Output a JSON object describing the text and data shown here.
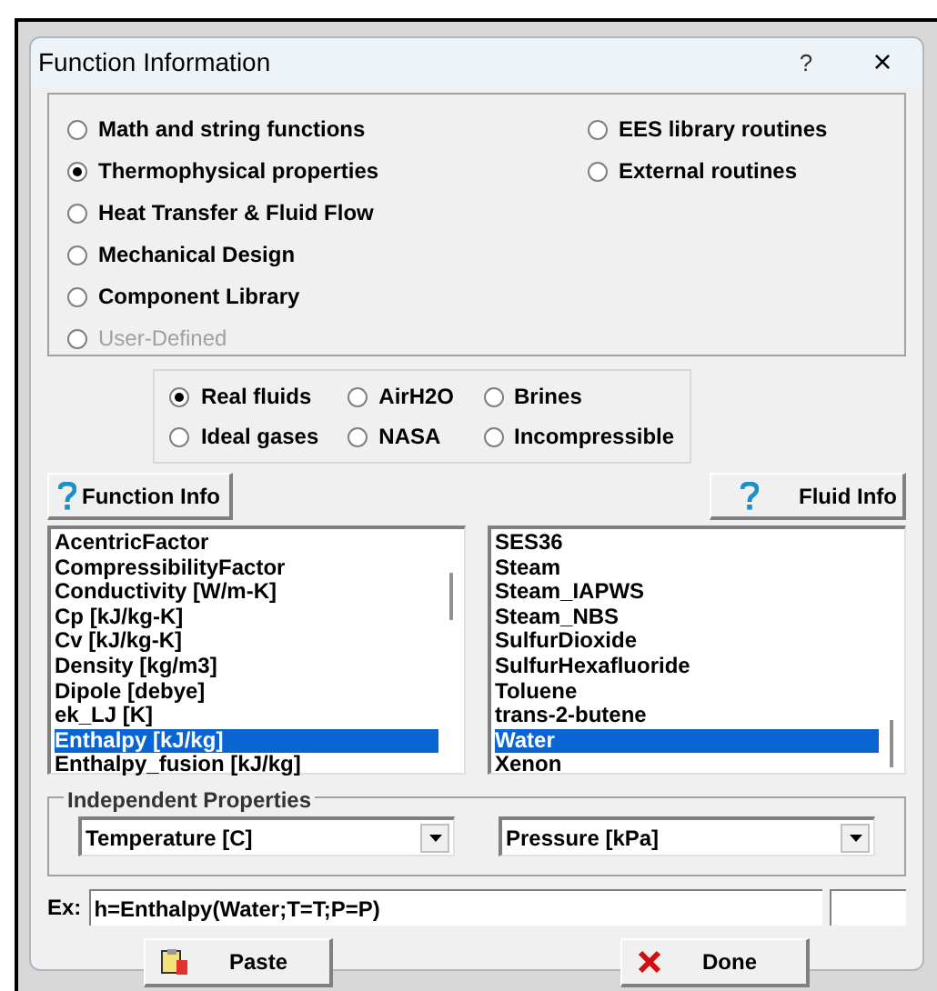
{
  "window": {
    "title": "Function Information",
    "help": "?",
    "close": "×"
  },
  "categories_left": [
    {
      "label": "Math and string functions",
      "selected": false,
      "disabled": false
    },
    {
      "label": "Thermophysical properties",
      "selected": true,
      "disabled": false
    },
    {
      "label": "Heat Transfer & Fluid Flow",
      "selected": false,
      "disabled": false
    },
    {
      "label": "Mechanical Design",
      "selected": false,
      "disabled": false
    },
    {
      "label": "Component Library",
      "selected": false,
      "disabled": false
    },
    {
      "label": "User-Defined",
      "selected": false,
      "disabled": true
    }
  ],
  "categories_right": [
    {
      "label": "EES library routines",
      "selected": false,
      "disabled": false
    },
    {
      "label": "External routines",
      "selected": false,
      "disabled": false
    }
  ],
  "fluid_types": [
    {
      "label": "Real fluids",
      "selected": true
    },
    {
      "label": "AirH2O",
      "selected": false
    },
    {
      "label": "Brines",
      "selected": false
    },
    {
      "label": "Ideal gases",
      "selected": false
    },
    {
      "label": "NASA",
      "selected": false
    },
    {
      "label": "Incompressible",
      "selected": false
    }
  ],
  "function_info_button": "Function Info",
  "fluid_info_button": "Fluid Info",
  "functions": [
    {
      "label": "AcentricFactor",
      "selected": false
    },
    {
      "label": "CompressibilityFactor",
      "selected": false
    },
    {
      "label": "Conductivity [W/m-K]",
      "selected": false
    },
    {
      "label": "Cp [kJ/kg-K]",
      "selected": false
    },
    {
      "label": "Cv [kJ/kg-K]",
      "selected": false
    },
    {
      "label": "Density [kg/m3]",
      "selected": false
    },
    {
      "label": "Dipole [debye]",
      "selected": false
    },
    {
      "label": "ek_LJ [K]",
      "selected": false
    },
    {
      "label": "Enthalpy [kJ/kg]",
      "selected": true
    },
    {
      "label": "Enthalpy_fusion [kJ/kg]",
      "selected": false
    }
  ],
  "fluids": [
    {
      "label": "SES36",
      "selected": false
    },
    {
      "label": "Steam",
      "selected": false
    },
    {
      "label": "Steam_IAPWS",
      "selected": false
    },
    {
      "label": "Steam_NBS",
      "selected": false
    },
    {
      "label": "SulfurDioxide",
      "selected": false
    },
    {
      "label": "SulfurHexafluoride",
      "selected": false
    },
    {
      "label": "Toluene",
      "selected": false
    },
    {
      "label": "trans-2-butene",
      "selected": false
    },
    {
      "label": "Water",
      "selected": true
    },
    {
      "label": "Xenon",
      "selected": false
    }
  ],
  "independent_properties": {
    "title": "Independent Properties",
    "first": "Temperature [C]",
    "second": "Pressure [kPa]"
  },
  "example": {
    "label": "Ex:",
    "value": "h=Enthalpy(Water;T=T;P=P)"
  },
  "buttons": [
    {
      "label": "Paste",
      "kind": "paste"
    },
    {
      "label": "Done",
      "kind": "done"
    }
  ]
}
